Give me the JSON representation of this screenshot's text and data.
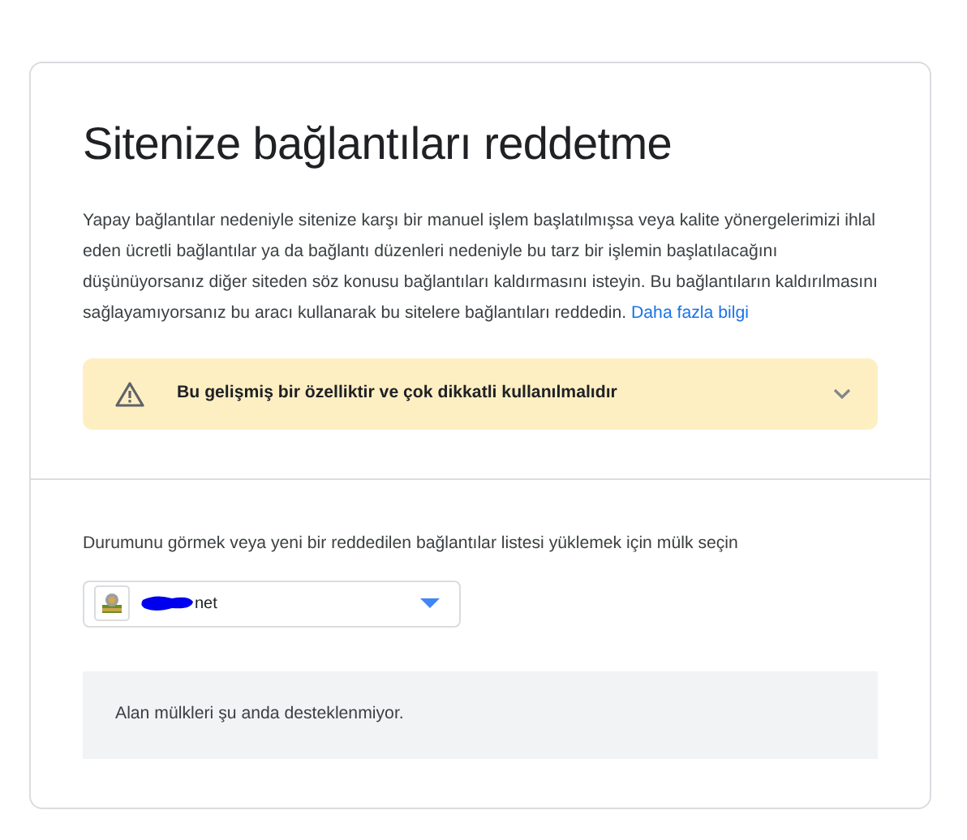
{
  "title": "Sitenize bağlantıları reddetme",
  "description": "Yapay bağlantılar nedeniyle sitenize karşı bir manuel işlem başlatılmışsa veya kalite yönergelerimizi ihlal eden ücretli bağlantılar ya da bağlantı düzenleri nedeniyle bu tarz bir işlemin başlatılacağını düşünüyorsanız diğer siteden söz konusu bağlantıları kaldırmasını isteyin. Bu bağlantıların kaldırılmasını sağlayamıyorsanız bu aracı kullanarak bu sitelere bağlantıları reddedin.",
  "learn_more_link": "Daha fazla bilgi",
  "warning": {
    "text": "Bu gelişmiş bir özelliktir ve çok dikkatli kullanılmalıdır",
    "expanded": false
  },
  "property_prompt": "Durumunu görmek veya yeni bir reddedilen bağlantılar listesi yüklemek için mülk seçin",
  "property_select": {
    "value": "net",
    "redacted": true
  },
  "notice": "Alan mülkleri şu anda desteklenmiyor."
}
